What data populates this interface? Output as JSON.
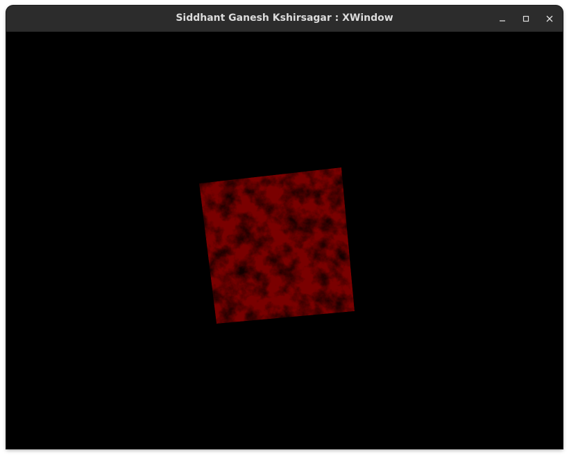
{
  "window": {
    "title": "Siddhant Ganesh Kshirsagar : XWindow",
    "controls": {
      "minimize_icon": "minimize-icon",
      "maximize_icon": "maximize-icon",
      "close_icon": "close-icon"
    }
  },
  "scene": {
    "background_color": "#000000",
    "object": "rotating textured square",
    "texture": "red marble",
    "base_color": "#7a0000",
    "vein_color": "#2a0000"
  }
}
